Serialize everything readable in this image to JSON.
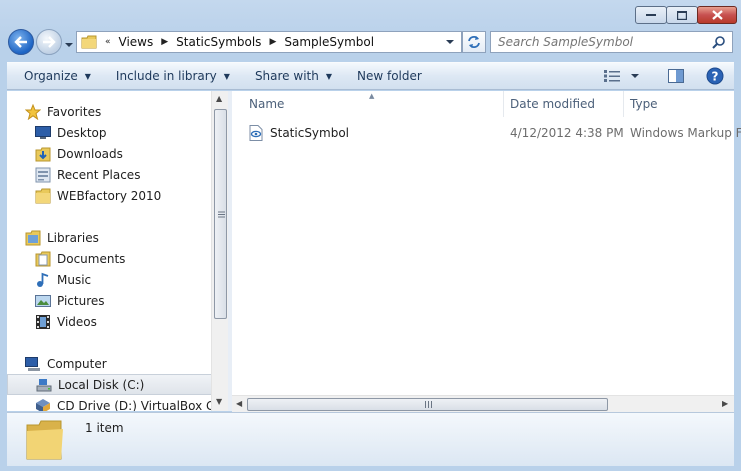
{
  "window": {
    "caption_buttons": [
      "minimize",
      "maximize",
      "close"
    ]
  },
  "address_bar": {
    "overflow_marker": "«",
    "breadcrumb": [
      "Views",
      "StaticSymbols",
      "SampleSymbol"
    ]
  },
  "search": {
    "placeholder": "Search SampleSymbol"
  },
  "toolbar": {
    "organize": "Organize",
    "include_in_library": "Include in library",
    "share_with": "Share with",
    "new_folder": "New folder"
  },
  "navigation": {
    "favorites": {
      "label": "Favorites",
      "items": [
        "Desktop",
        "Downloads",
        "Recent Places",
        "WEBfactory 2010"
      ]
    },
    "libraries": {
      "label": "Libraries",
      "items": [
        "Documents",
        "Music",
        "Pictures",
        "Videos"
      ]
    },
    "computer": {
      "label": "Computer",
      "items": [
        "Local Disk (C:)",
        "CD Drive (D:) VirtualBox Guest"
      ]
    }
  },
  "columns": {
    "name": "Name",
    "date_modified": "Date modified",
    "type": "Type"
  },
  "files": [
    {
      "name": "StaticSymbol",
      "date_modified": "4/12/2012 4:38 PM",
      "type": "Windows Markup Fi"
    }
  ],
  "details": {
    "item_count": "1 item"
  },
  "colors": {
    "frame": "#b9d1ea",
    "toolbar_text": "#1e395b",
    "header_text": "#4c607a",
    "secondary_text": "#6d6d6d"
  }
}
